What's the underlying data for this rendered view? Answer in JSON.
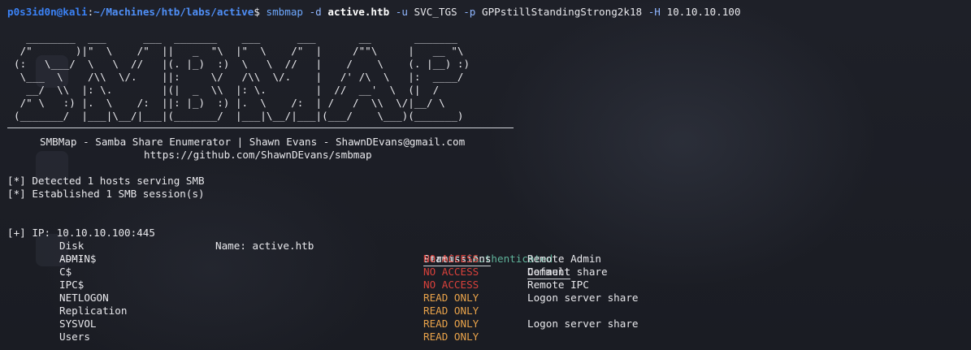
{
  "prompt": {
    "user": "p0s3id0n@kali",
    "sep": ":",
    "path": "~/Machines/htb/labs/active",
    "dollar": "$",
    "command": "smbmap",
    "flag_d": "-d",
    "domain": "active.htb",
    "flag_u": "-u",
    "username": "SVC_TGS",
    "flag_p": "-p",
    "password": "GPPstillStandingStrong2k18",
    "flag_h": "-H",
    "host": "10.10.10.100"
  },
  "banner": [
    "  ________  ___      ___  _______    ___      ___       __       _______",
    " /\"       )|\"  \\    /\"  ||   _  \"\\  |\"  \\    /\"  |     /\"\"\\     |   __ \"\\",
    "(:   \\___/  \\   \\  //   |(. |_)  :)  \\   \\  //   |    /    \\    (. |__) :)",
    " \\___  \\    /\\\\  \\/.    ||:     \\/   /\\\\  \\/.    |   /' /\\  \\   |:  ____/",
    "  __/  \\\\  |: \\.        |(|  _  \\\\  |: \\.        |  //  __'  \\  (|  /",
    " /\" \\   :) |.  \\    /:  ||: |_)  :) |.  \\    /:  | /   /  \\\\  \\/|__/ \\",
    "(_______/  |___|\\__/|___|(_______/  |___|\\__/|___|(___/    \\___)(_______)"
  ],
  "tagline": "SMBMap - Samba Share Enumerator | Shawn Evans - ShawnDEvans@gmail.com",
  "url": "https://github.com/ShawnDEvans/smbmap",
  "info": [
    "[*] Detected 1 hosts serving SMB",
    "[*] Established 1 SMB session(s)"
  ],
  "result": {
    "ip_label": "[+] IP: 10.10.10.100:445",
    "name_label": "Name: active.htb",
    "status_label": "Status:",
    "status_value": "Authenticated"
  },
  "headers": {
    "disk": "Disk",
    "disk_ul": "----",
    "permissions": "Permissions",
    "comment": "Comment"
  },
  "shares": [
    {
      "disk": "ADMIN$",
      "perm": "NO ACCESS",
      "perm_level": "none",
      "comment": "Remote Admin"
    },
    {
      "disk": "C$",
      "perm": "NO ACCESS",
      "perm_level": "none",
      "comment": "Default share"
    },
    {
      "disk": "IPC$",
      "perm": "NO ACCESS",
      "perm_level": "none",
      "comment": "Remote IPC"
    },
    {
      "disk": "NETLOGON",
      "perm": "READ ONLY",
      "perm_level": "read",
      "comment": "Logon server share"
    },
    {
      "disk": "Replication",
      "perm": "READ ONLY",
      "perm_level": "read",
      "comment": ""
    },
    {
      "disk": "SYSVOL",
      "perm": "READ ONLY",
      "perm_level": "read",
      "comment": "Logon server share"
    },
    {
      "disk": "Users",
      "perm": "READ ONLY",
      "perm_level": "read",
      "comment": ""
    }
  ],
  "colors": {
    "background": "#1b1d24",
    "authenticated": "#5fb39a",
    "no_access": "#d9413b",
    "read_only": "#e8a24a",
    "prompt_user": "#3b82f6"
  }
}
